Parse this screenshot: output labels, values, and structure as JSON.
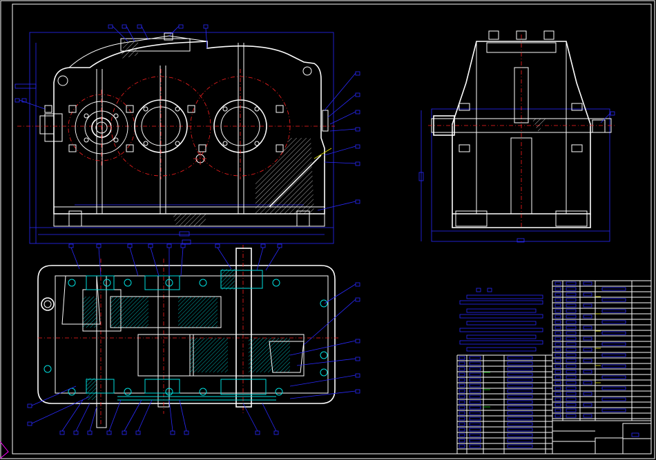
{
  "drawing": {
    "background": "#000000",
    "colors": {
      "outline": "#ffffff",
      "centerline": "#ff2020",
      "dimension": "#2a2aff",
      "section": "#00e0e0",
      "accent_yellow": "#e8e800",
      "accent_green": "#00c800",
      "frame_corner": "#ff00ff"
    },
    "views": [
      "front-view",
      "side-view",
      "top-section-view",
      "parts-list-table",
      "title-block"
    ],
    "icons": [
      "gearbox-housing",
      "gear-circle",
      "bolt-symbol",
      "leader-balloon"
    ]
  }
}
